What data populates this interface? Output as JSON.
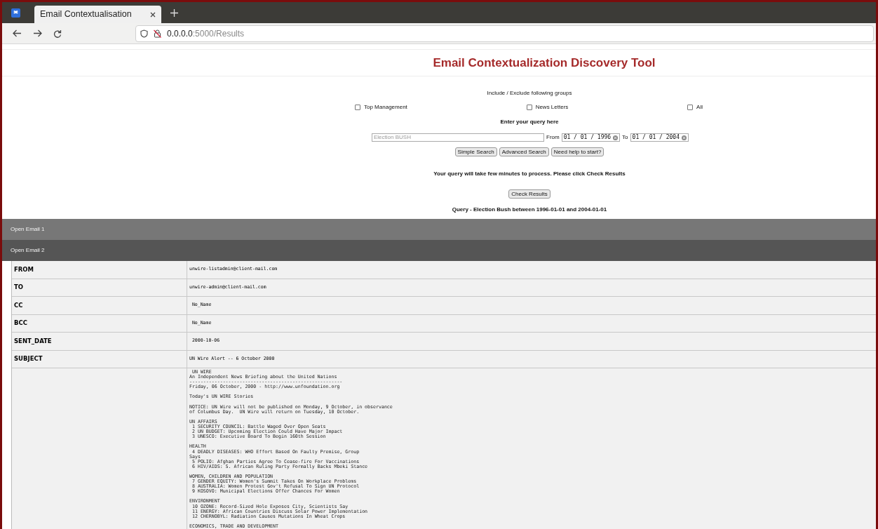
{
  "browser": {
    "tab_title": "Email Contextualisation",
    "url_host": "0.0.0.0",
    "url_path": ":5000/Results"
  },
  "page": {
    "title": "Email Contextualization Discovery Tool",
    "groups_label": "Include / Exclude following groups",
    "groups": [
      {
        "label": "Top Management",
        "checked": false
      },
      {
        "label": "News Letters",
        "checked": false
      },
      {
        "label": "All",
        "checked": false
      }
    ],
    "query_label": "Enter your query here",
    "query_placeholder": "Election BUSH",
    "from_label": "From",
    "from_date": "01 / 01 / 1996",
    "to_label": "To",
    "to_date": "01 / 01 / 2004",
    "buttons": [
      "Simple Search",
      "Advanced Search",
      "Need help to start?"
    ],
    "notice": "Your query will take few minutes to process. Please click Check Results",
    "check_button": "Check Results",
    "query_summary": "Query - Election Bush between 1996-01-01 and 2004-01-01"
  },
  "emails": [
    {
      "label": "Open Email 1",
      "expanded": false
    },
    {
      "label": "Open Email 2",
      "expanded": true
    }
  ],
  "email_table": [
    {
      "field": "FROM",
      "value": "unwire-listadmin@client-mail.com"
    },
    {
      "field": "TO",
      "value": "unwire-admin@client-mail.com"
    },
    {
      "field": "CC",
      "value": " No_Name"
    },
    {
      "field": "BCC",
      "value": " No_Name"
    },
    {
      "field": "SENT_DATE",
      "value": " 2000-10-06"
    },
    {
      "field": "SUBJECT",
      "value": "UN Wire Alert -- 6 October 2000"
    }
  ],
  "email_body": " UN WIRE\nAn Independent News Briefing about the United Nations\n-------------------------------------------------------\nFriday, 06 October, 2000 - http://www.unfoundation.org\n\nToday's UN WIRE Stories\n\nNOTICE: UN Wire will not be published on Monday, 9 October, in observance\nof Columbus Day.  UN Wire will return on Tuesday, 10 October.\n\nUN AFFAIRS\n 1 SECURITY COUNCIL: Battle Waged Over Open Seats\n 2 UN BUDGET: Upcoming Election Could Have Major Impact\n 3 UNESCO: Executive Board To Begin 160th Session\n\nHEALTH\n 4 DEADLY DISEASES: WHO Effort Based On Faulty Premise, Group\nSays\n 5 POLIO: Afghan Parties Agree To Cease-fire For Vaccinations\n 6 HIV/AIDS: S. African Ruling Party Formally Backs Mbeki Stance\n\nWOMEN, CHILDREN AND POPULATION\n 7 GENDER EQUITY: Women's Summit Takes On Workplace Problems\n 8 AUSTRALIA: Women Protest Gov't Refusal To Sign UN Protocol\n 9 KOSOVO: Municipal Elections Offer Chances For Women\n\nENVIRONMENT\n 10 OZONE: Record-Sized Hole Exposes City, Scientists Say\n 11 ENERGY: African Countries Discuss Solar Power Implementation\n 12 CHERNOBYL: Radiation Causes Mutations In Wheat Crops\n\nECONOMICS, TRADE AND DEVELOPMENT"
}
